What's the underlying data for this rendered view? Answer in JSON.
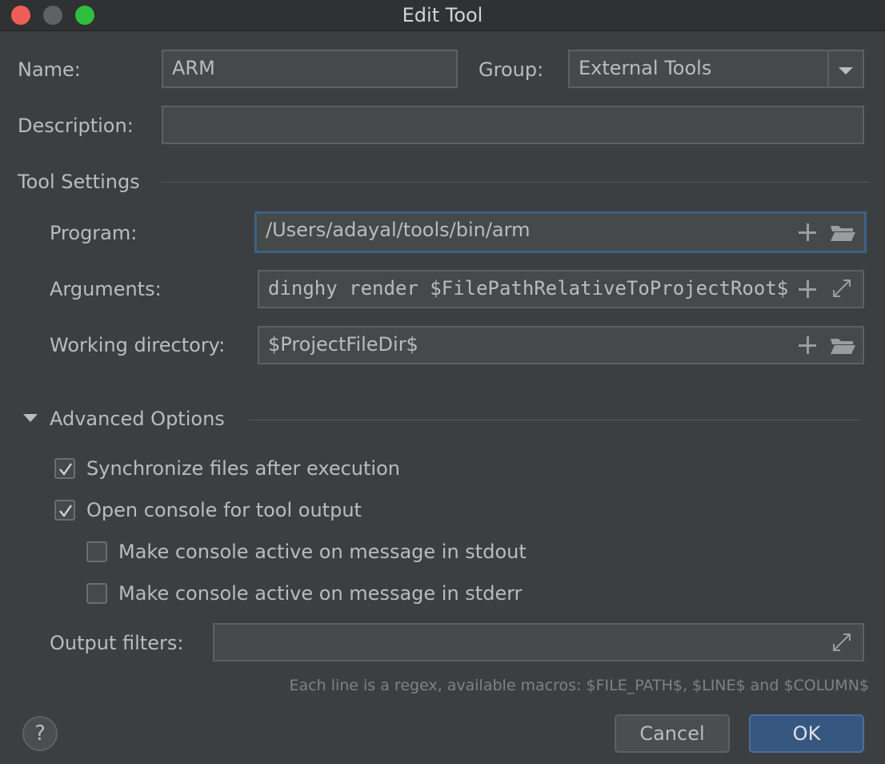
{
  "window": {
    "title": "Edit Tool"
  },
  "form": {
    "name_label": "Name:",
    "name_value": "ARM",
    "group_label": "Group:",
    "group_value": "External Tools",
    "description_label": "Description:",
    "description_value": ""
  },
  "tool_settings": {
    "heading": "Tool Settings",
    "program_label": "Program:",
    "program_value": "/Users/adayal/tools/bin/arm",
    "arguments_label": "Arguments:",
    "arguments_value": "dinghy render $FilePathRelativeToProjectRoot$",
    "workdir_label": "Working directory:",
    "workdir_value": "$ProjectFileDir$"
  },
  "advanced": {
    "heading": "Advanced Options",
    "sync_label": "Synchronize files after execution",
    "sync_checked": true,
    "console_label": "Open console for tool output",
    "console_checked": true,
    "stdout_label": "Make console active on message in stdout",
    "stdout_checked": false,
    "stderr_label": "Make console active on message in stderr",
    "stderr_checked": false,
    "filters_label": "Output filters:",
    "filters_value": "",
    "hint": "Each line is a regex, available macros: $FILE_PATH$, $LINE$ and $COLUMN$"
  },
  "buttons": {
    "help": "?",
    "cancel": "Cancel",
    "ok": "OK"
  },
  "icons": {
    "add": "plus-icon",
    "browse": "folder-icon",
    "expand": "expand-icon",
    "dropdown": "chevron-down-icon",
    "collapse": "triangle-down-icon"
  },
  "colors": {
    "background": "#3c3f41",
    "field": "#45494a",
    "focus_border": "#3d6185",
    "ok_button": "#365880",
    "close": "#ee5e57",
    "zoom": "#2fbe3f"
  }
}
